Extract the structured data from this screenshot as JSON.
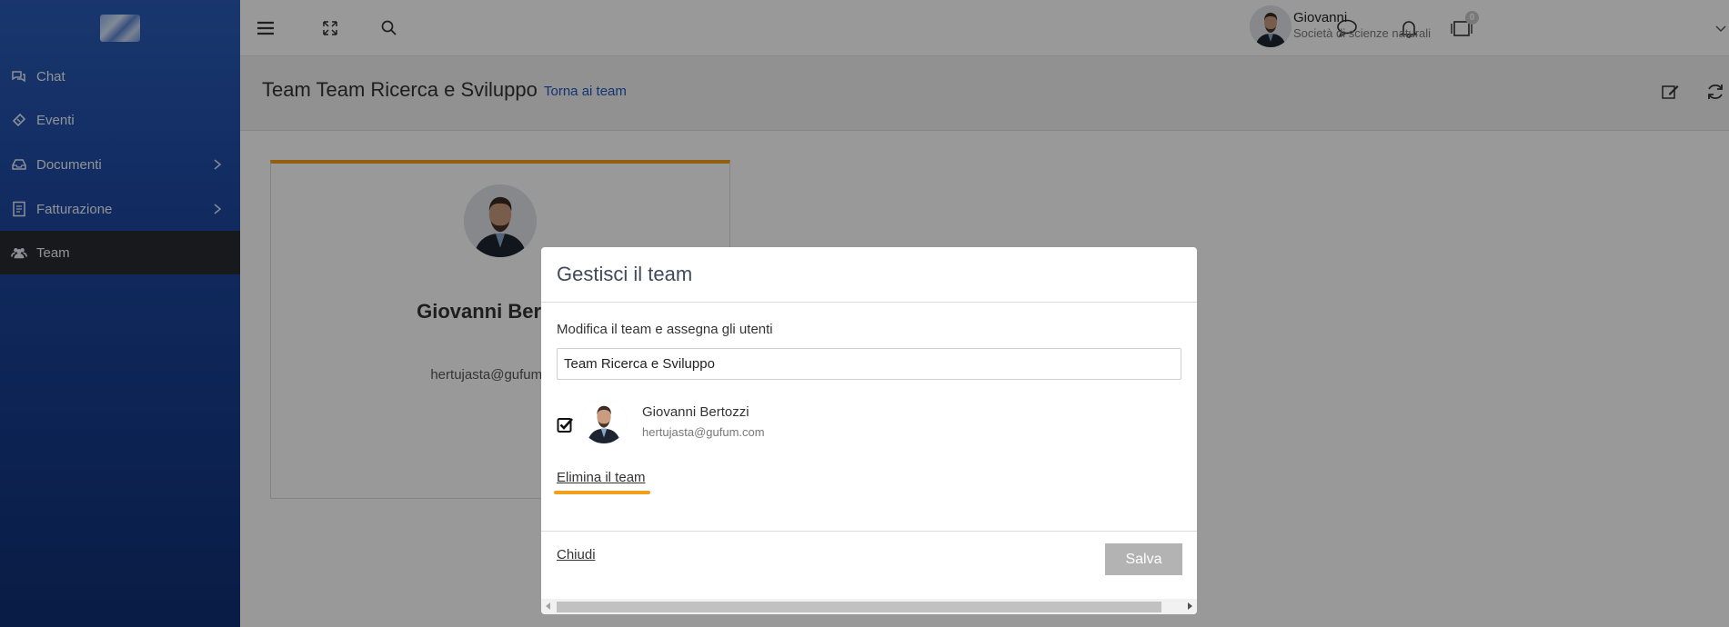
{
  "sidebar": {
    "items": [
      {
        "label": "Chat",
        "icon": "chat-icon"
      },
      {
        "label": "Eventi",
        "icon": "ticket-icon"
      },
      {
        "label": "Documenti",
        "icon": "inbox-icon",
        "has_submenu": true
      },
      {
        "label": "Fatturazione",
        "icon": "invoice-icon",
        "has_submenu": true
      },
      {
        "label": "Team",
        "icon": "users-icon",
        "active": true
      }
    ]
  },
  "topbar": {
    "notification_count": "0",
    "user": {
      "name": "Giovanni",
      "organization": "Società di scienze naturali"
    }
  },
  "page": {
    "title": "Team Team Ricerca e Sviluppo",
    "back_link": "Torna ai team"
  },
  "card": {
    "name": "Giovanni Bertozzi",
    "email": "hertujasta@gufum.com"
  },
  "modal": {
    "title": "Gestisci il team",
    "description": "Modifica il team e assegna gli utenti",
    "team_name_value": "Team Ricerca e Sviluppo",
    "members": [
      {
        "name": "Giovanni Bertozzi",
        "email": "hertujasta@gufum.com",
        "checked": true
      }
    ],
    "delete_label": "Elimina il team",
    "close_label": "Chiudi",
    "save_label": "Salva"
  },
  "colors": {
    "accent": "#f0a01a",
    "sidebar_top": "#2a5cb8",
    "sidebar_bottom": "#0f2f73",
    "link": "#1f56c2",
    "save_disabled": "#b3b3b3"
  }
}
